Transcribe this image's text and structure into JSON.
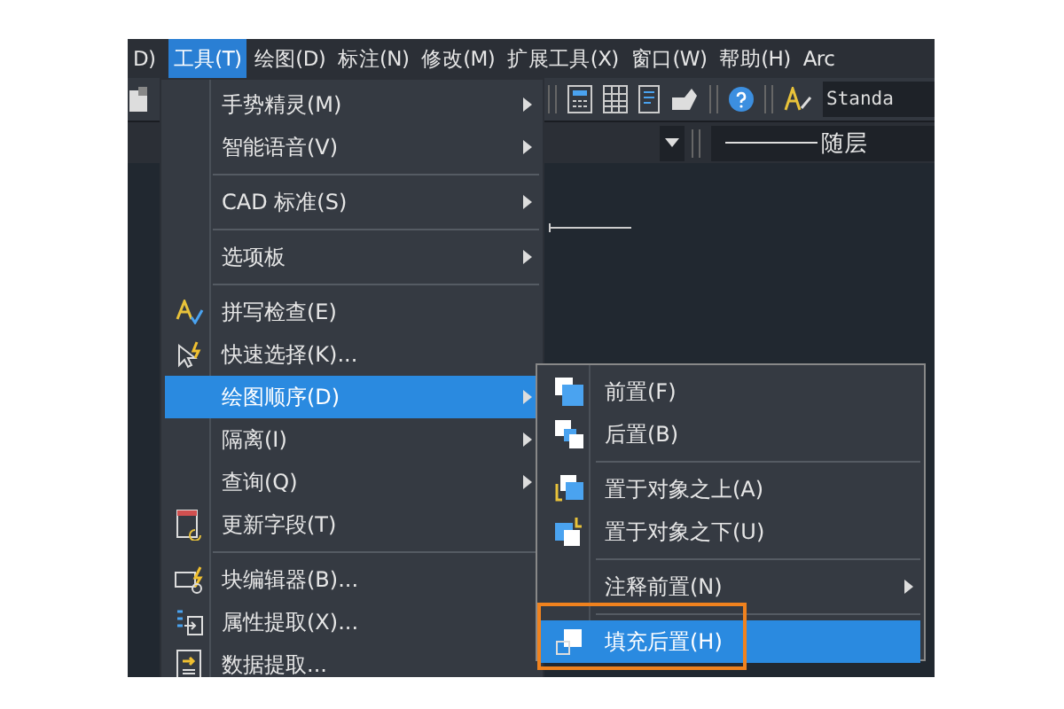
{
  "menu_bar": {
    "items": [
      {
        "label": "D)",
        "selected": false
      },
      {
        "label": "工具(T)",
        "selected": true
      },
      {
        "label": "绘图(D)",
        "selected": false
      },
      {
        "label": "标注(N)",
        "selected": false
      },
      {
        "label": "修改(M)",
        "selected": false
      },
      {
        "label": "扩展工具(X)",
        "selected": false
      },
      {
        "label": "窗口(W)",
        "selected": false
      },
      {
        "label": "帮助(H)",
        "selected": false
      },
      {
        "label": "Arc",
        "selected": false
      }
    ]
  },
  "toolbar": {
    "text_style": "Standa",
    "layer_linetype": "随层"
  },
  "tools_menu": {
    "items": [
      {
        "kind": "item",
        "label": "手势精灵(M)",
        "submenu": true,
        "selected": false
      },
      {
        "kind": "item",
        "label": "智能语音(V)",
        "submenu": true,
        "selected": false
      },
      {
        "kind": "separator"
      },
      {
        "kind": "item",
        "label": "CAD 标准(S)",
        "submenu": true,
        "selected": false
      },
      {
        "kind": "separator"
      },
      {
        "kind": "item",
        "label": "选项板",
        "submenu": true,
        "selected": false
      },
      {
        "kind": "separator"
      },
      {
        "kind": "item",
        "label": "拼写检查(E)",
        "submenu": false,
        "selected": false
      },
      {
        "kind": "item",
        "label": "快速选择(K)...",
        "submenu": false,
        "selected": false
      },
      {
        "kind": "item",
        "label": "绘图顺序(D)",
        "submenu": true,
        "selected": true
      },
      {
        "kind": "item",
        "label": "隔离(I)",
        "submenu": true,
        "selected": false
      },
      {
        "kind": "item",
        "label": "查询(Q)",
        "submenu": true,
        "selected": false
      },
      {
        "kind": "item",
        "label": "更新字段(T)",
        "submenu": false,
        "selected": false
      },
      {
        "kind": "separator"
      },
      {
        "kind": "item",
        "label": "块编辑器(B)...",
        "submenu": false,
        "selected": false
      },
      {
        "kind": "item",
        "label": "属性提取(X)...",
        "submenu": false,
        "selected": false
      },
      {
        "kind": "item",
        "label": "数据提取...",
        "submenu": false,
        "selected": false
      }
    ]
  },
  "draw_order_menu": {
    "items": [
      {
        "kind": "item",
        "label": "前置(F)",
        "submenu": false,
        "selected": false,
        "outlined": false
      },
      {
        "kind": "item",
        "label": "后置(B)",
        "submenu": false,
        "selected": false,
        "outlined": false
      },
      {
        "kind": "separator"
      },
      {
        "kind": "item",
        "label": "置于对象之上(A)",
        "submenu": false,
        "selected": false,
        "outlined": false
      },
      {
        "kind": "item",
        "label": "置于对象之下(U)",
        "submenu": false,
        "selected": false,
        "outlined": false
      },
      {
        "kind": "separator"
      },
      {
        "kind": "item",
        "label": "注释前置(N)",
        "submenu": true,
        "selected": false,
        "outlined": false
      },
      {
        "kind": "separator"
      },
      {
        "kind": "item",
        "label": "填充后置(H)",
        "submenu": false,
        "selected": true,
        "outlined": true
      }
    ]
  }
}
